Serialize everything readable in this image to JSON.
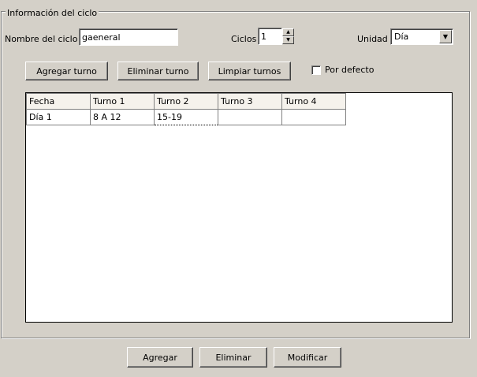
{
  "cycle_info": {
    "legend": "Información del ciclo",
    "name_label": "Nombre del ciclo",
    "name_value": "gaeneral",
    "cycles_label": "Ciclos",
    "cycles_value": "1",
    "unit_label": "Unidad",
    "unit_value": "Día"
  },
  "toolbar": {
    "add_turn": "Agregar turno",
    "remove_turn": "Eliminar turno",
    "clear_turns": "Limpiar turnos",
    "default_label": "Por defecto",
    "default_checked": false
  },
  "table": {
    "headers": [
      "Fecha",
      "Turno 1",
      "Turno 2",
      "Turno 3",
      "Turno 4"
    ],
    "rows": [
      [
        "Día 1",
        "8 A 12",
        "15-19",
        "",
        ""
      ]
    ]
  },
  "footer": {
    "add": "Agregar",
    "remove": "Eliminar",
    "modify": "Modificar"
  }
}
